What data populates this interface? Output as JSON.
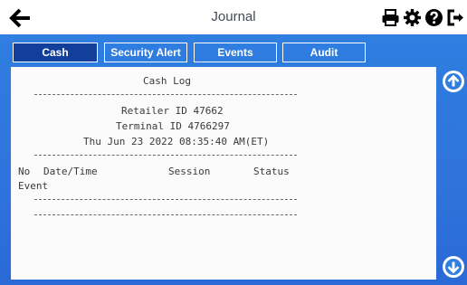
{
  "header": {
    "title": "Journal"
  },
  "icons": {
    "back": "arrow-left-icon",
    "print": "printer-icon",
    "settings": "gear-icon",
    "help": "question-circle-icon",
    "exit": "exit-icon",
    "scroll_up": "arrow-circle-up-icon",
    "scroll_down": "arrow-circle-down-icon"
  },
  "tabs": [
    {
      "label": "Cash",
      "active": true
    },
    {
      "label": "Security Alert",
      "active": false
    },
    {
      "label": "Events",
      "active": false
    },
    {
      "label": "Audit",
      "active": false
    }
  ],
  "log": {
    "title": "Cash Log",
    "retailer": "Retailer ID 47662",
    "terminal": "Terminal ID 4766297",
    "datetime": "Thu Jun 23 2022 08:35:40 AM(ET)",
    "columns": {
      "no": "No",
      "datetime": "Date/Time",
      "session": "Session",
      "status": "Status"
    },
    "row_label": "Event"
  },
  "colors": {
    "panel_blue": "#2f7ee0",
    "active_tab": "#123f9a",
    "log_text": "#3a3a3a"
  }
}
